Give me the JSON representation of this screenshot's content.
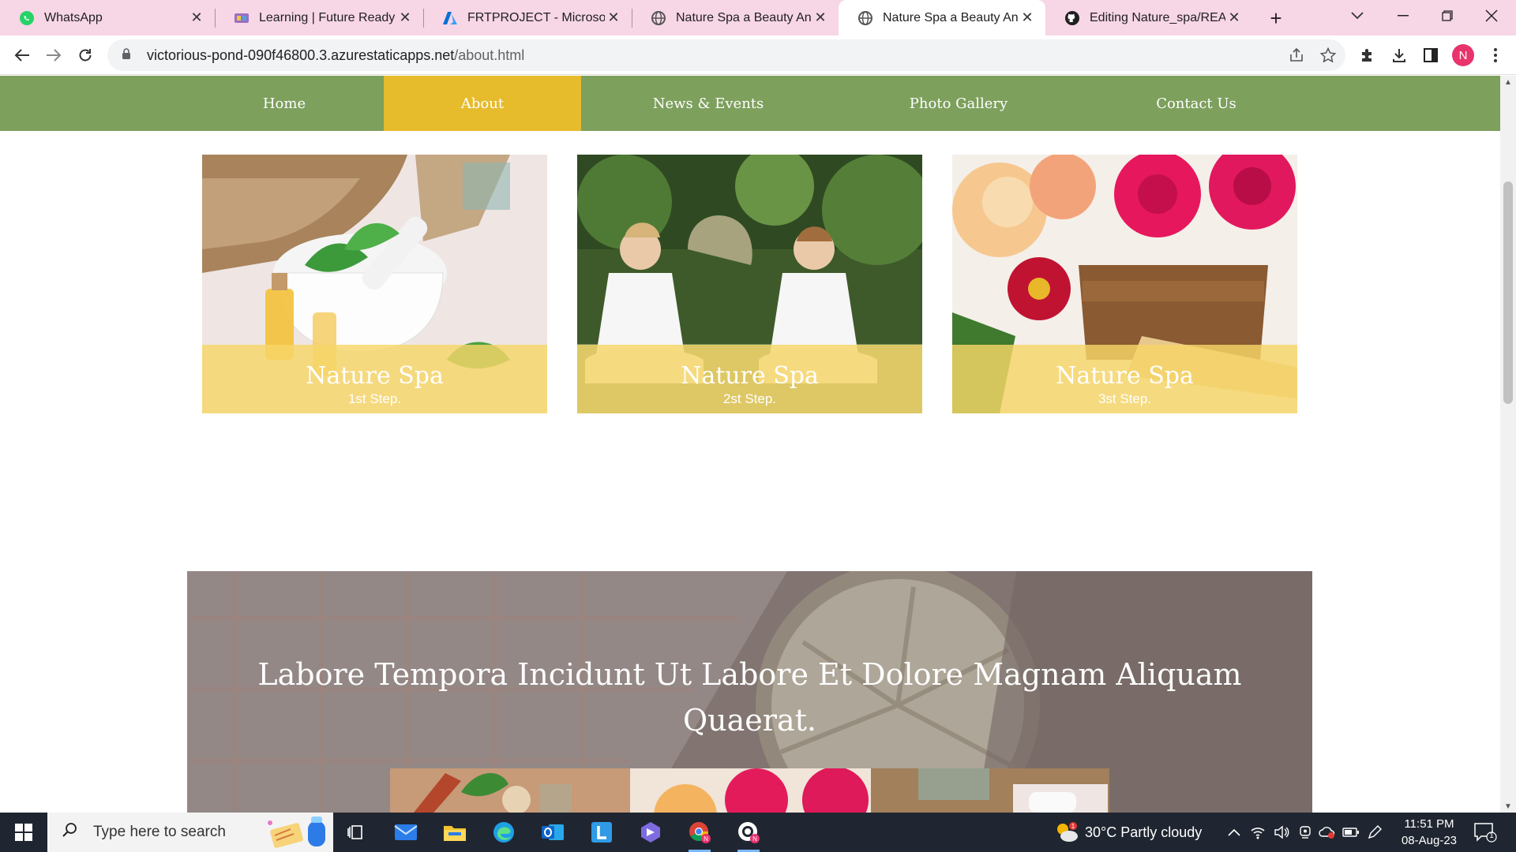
{
  "tabs": [
    {
      "title": "WhatsApp",
      "icon": "whatsapp-icon"
    },
    {
      "title": "Learning | Future Ready Talent",
      "icon": "future-ready-icon"
    },
    {
      "title": "FRTPROJECT - Microsoft Azure",
      "icon": "azure-icon"
    },
    {
      "title": "Nature Spa a Beauty And Spa",
      "icon": "globe-icon"
    },
    {
      "title": "Nature Spa a Beauty And Spa",
      "icon": "globe-icon"
    },
    {
      "title": "Editing Nature_spa/README",
      "icon": "github-icon"
    }
  ],
  "active_tab": 4,
  "address": {
    "domain": "victorious-pond-090f46800.3.azurestaticapps.net",
    "path": "/about.html"
  },
  "profile_initial": "N",
  "site_nav": [
    "Home",
    "About",
    "News & Events",
    "Photo Gallery",
    "Contact Us"
  ],
  "site_nav_active": 1,
  "cards": [
    {
      "title": "Nature Spa",
      "subtitle": "1st Step."
    },
    {
      "title": "Nature Spa",
      "subtitle": "2st Step."
    },
    {
      "title": "Nature Spa",
      "subtitle": "3st Step."
    }
  ],
  "hero_heading": "Labore Tempora Incidunt Ut Labore Et Dolore Magnam Aliquam Quaerat.",
  "taskbar": {
    "search_placeholder": "Type here to search",
    "weather": "30°C  Partly cloudy",
    "time": "11:51 PM",
    "date": "08-Aug-23",
    "notification_count": "1"
  },
  "colors": {
    "tab_strip": "#f7d6e6",
    "site_nav": "#7da05d",
    "site_nav_active": "#e6bb2c",
    "card_band": "#f6d668",
    "taskbar": "#202631"
  }
}
